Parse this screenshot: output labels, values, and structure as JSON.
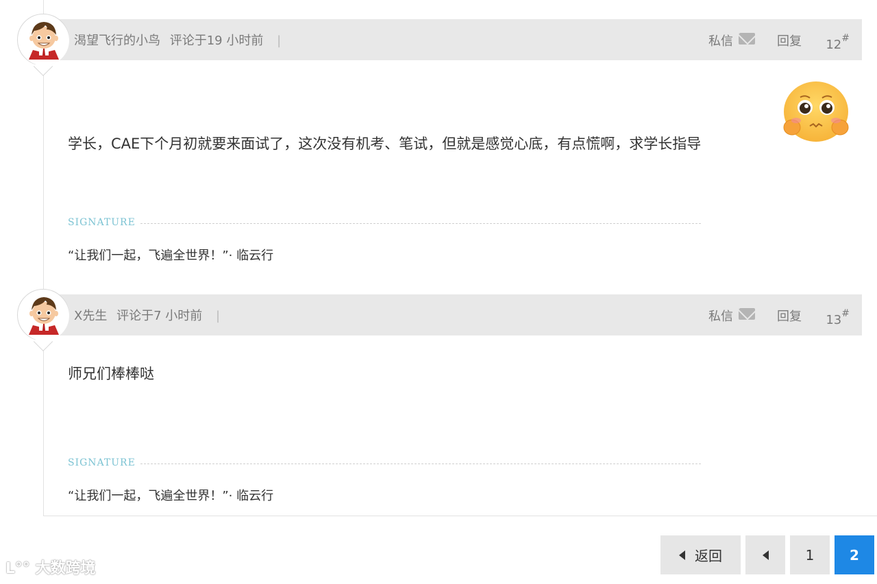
{
  "comments": [
    {
      "author": "渴望飞行的小鸟",
      "posted": "评论于19 小时前",
      "separator": "|",
      "message_label": "私信",
      "reply_label": "回复",
      "floor": "12",
      "floor_mark": "#",
      "content": "学长，CAE下个月初就要来面试了，这次没有机考、笔试，但就是感觉心底，有点慌啊，求学长指导",
      "emoji": "worried-face-emoji",
      "signature_label": "SIGNATURE",
      "signature": "“让我们一起，飞遍全世界！”· 临云行"
    },
    {
      "author": "X先生",
      "posted": "评论于7 小时前",
      "separator": "|",
      "message_label": "私信",
      "reply_label": "回复",
      "floor": "13",
      "floor_mark": "#",
      "content": "师兄们棒棒哒",
      "signature_label": "SIGNATURE",
      "signature": "“让我们一起，飞遍全世界！”· 临云行"
    }
  ],
  "pagination": {
    "back_label": "返回",
    "prev_icon": "left-triangle-icon",
    "pages": [
      "1",
      "2"
    ],
    "current_page": "2"
  },
  "watermark": "大数跨境",
  "colors": {
    "header_bg": "#e8e8e8",
    "active_page": "#1e88e5",
    "signature_label": "#7cc3d3",
    "meta_text": "#7a7a7a"
  }
}
